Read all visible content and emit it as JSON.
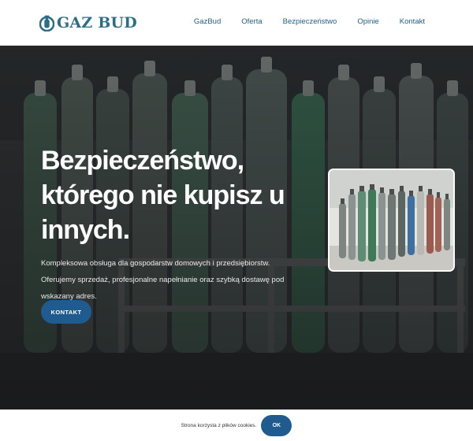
{
  "brand": {
    "name": "GAZ BUD",
    "logo_icon": "gas-cylinder-logo-icon",
    "color": "#2b6f86"
  },
  "nav": {
    "items": [
      {
        "label": "GazBud"
      },
      {
        "label": "Oferta"
      },
      {
        "label": "Bezpieczeństwo"
      },
      {
        "label": "Opinie"
      },
      {
        "label": "Kontakt"
      }
    ],
    "color": "#1f5f86"
  },
  "hero": {
    "title_lines": [
      "Bezpieczeństwo,",
      "którego nie kupisz u",
      "innych."
    ],
    "description": "Kompleksowa obsługa dla gospodarstw domowych i przedsiębiorstw. Oferujemy sprzedaż, profesjonalne napełnianie oraz szybką dostawę pod wskazany adres.",
    "cta_label": "KONTAKT",
    "background_subject": "gas cylinders in storage rack",
    "photo_subject": "gas cylinders in warehouse"
  },
  "cookie": {
    "text": "Strona korzysta z plików cookies.",
    "button_label": "OK"
  },
  "colors": {
    "accent": "#1f5b8e",
    "hero_text": "#ffffff"
  }
}
